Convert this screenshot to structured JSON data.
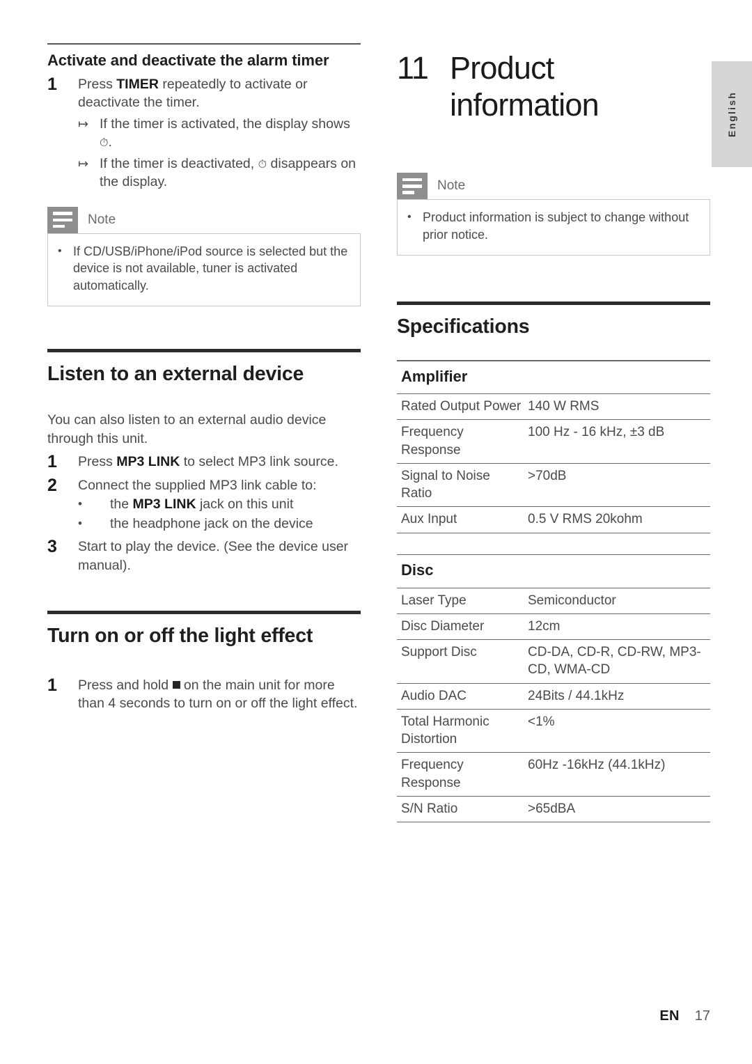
{
  "page": {
    "language_tab": "English",
    "footer": {
      "locale": "EN",
      "page_number": "17"
    }
  },
  "left_column": {
    "section_alarm": {
      "heading": "Activate and deactivate the alarm timer",
      "steps": [
        {
          "number": "1",
          "text_before_bold": "Press ",
          "bold": "TIMER",
          "text_after_bold": " repeatedly to activate or deactivate the timer."
        }
      ],
      "sub_results": [
        {
          "arrow": "↦",
          "text_before": "If the timer is activated, the display shows ",
          "glyph": "timer-icon",
          "text_after": "."
        },
        {
          "arrow": "↦",
          "text_before": "If the timer is deactivated, ",
          "glyph": "timer-icon",
          "text_after": " disappears on the display."
        }
      ],
      "note": {
        "title": "Note",
        "icon": "note-lines-icon",
        "items": [
          "If CD/USB/iPhone/iPod source is selected but the device is not available, tuner is activated automatically."
        ]
      }
    },
    "section_external": {
      "heading": "Listen to an external device",
      "intro": "You can also listen to an external audio device through this unit.",
      "steps": [
        {
          "number": "1",
          "text_before_bold": "Press ",
          "bold": "MP3 LINK",
          "text_after_bold": " to select MP3 link source."
        },
        {
          "number": "2",
          "text_before_bold": "Connect the supplied MP3 link cable to:",
          "bold": "",
          "text_after_bold": ""
        },
        {
          "number": "3",
          "text_before_bold": "Start to play the device. (See the device user manual).",
          "bold": "",
          "text_after_bold": ""
        }
      ],
      "step2_bullets": [
        {
          "text_before": "the ",
          "bold": "MP3 LINK",
          "text_after": " jack on this unit"
        },
        {
          "text_before": "the headphone jack on the device",
          "bold": "",
          "text_after": ""
        }
      ]
    },
    "section_light": {
      "heading": "Turn on or off the light effect",
      "steps": [
        {
          "number": "1",
          "text_before_glyph": "Press and hold ",
          "glyph": "stop-square-icon",
          "text_after_glyph": " on the main unit for more than 4 seconds to turn on or off the light effect."
        }
      ]
    }
  },
  "right_column": {
    "chapter": {
      "number": "11",
      "title_line1": "Product",
      "title_line2": "information"
    },
    "note": {
      "title": "Note",
      "icon": "note-lines-icon",
      "items": [
        "Product information is subject to change without prior notice."
      ]
    },
    "specifications": {
      "heading": "Specifications",
      "tables": [
        {
          "subhead": "Amplifier",
          "rows": [
            {
              "key": "Rated Output Power",
              "value": "140 W RMS"
            },
            {
              "key": "Frequency Response",
              "value": "100 Hz - 16 kHz, ±3 dB"
            },
            {
              "key": "Signal to Noise Ratio",
              "value": ">70dB"
            },
            {
              "key": "Aux Input",
              "value": "0.5 V RMS 20kohm"
            }
          ]
        },
        {
          "subhead": "Disc",
          "rows": [
            {
              "key": "Laser Type",
              "value": "Semiconductor"
            },
            {
              "key": "Disc Diameter",
              "value": "12cm"
            },
            {
              "key": "Support Disc",
              "value": "CD-DA, CD-R, CD-RW, MP3-CD, WMA-CD"
            },
            {
              "key": "Audio DAC",
              "value": "24Bits / 44.1kHz"
            },
            {
              "key": "Total Harmonic Distortion",
              "value": "<1%"
            },
            {
              "key": "Frequency Response",
              "value": "60Hz -16kHz (44.1kHz)"
            },
            {
              "key": "S/N Ratio",
              "value": ">65dBA"
            }
          ]
        }
      ]
    }
  },
  "colors": {
    "heading_rule": "#2d2b2c",
    "thin_rule": "#58565a",
    "body_text": "#4c4a4b",
    "bold_text": "#1b1a1a",
    "note_icon_bg": "#8e8e8e",
    "note_border": "#c9c7cc",
    "lang_tab_bg": "#d4d6d8"
  }
}
